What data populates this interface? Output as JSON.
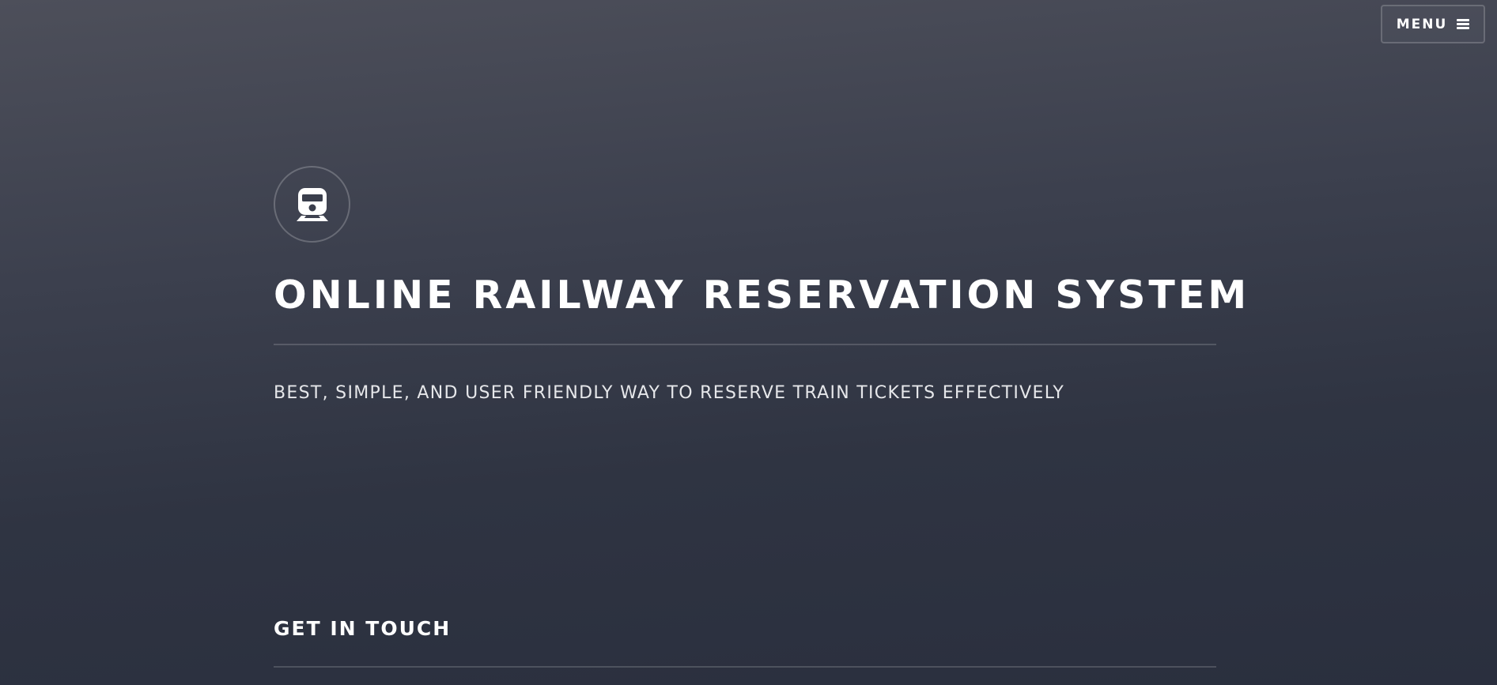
{
  "header": {
    "menu_label": "MENU",
    "menu_icon": "hamburger-icon"
  },
  "hero": {
    "logo_icon": "train-icon",
    "title": "ONLINE RAILWAY RESERVATION SYSTEM",
    "tagline": "BEST, SIMPLE, AND USER FRIENDLY WAY TO RESERVE TRAIN TICKETS EFFECTIVELY"
  },
  "contact": {
    "heading": "GET IN TOUCH"
  },
  "colors": {
    "background_top": "#4d4f5a",
    "background_bottom": "#2a2f3e",
    "text": "#ffffff"
  }
}
